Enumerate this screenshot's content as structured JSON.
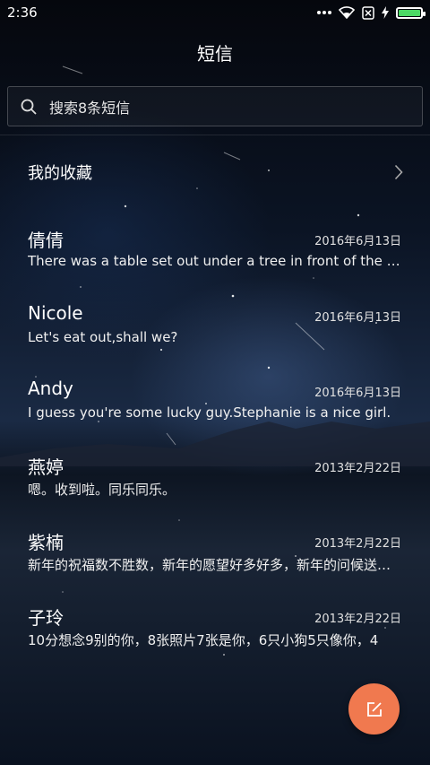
{
  "status_bar": {
    "time": "2:36",
    "icons": [
      "more-dots-icon",
      "wifi-icon",
      "sim-disabled-icon",
      "charging-icon",
      "battery-icon"
    ],
    "battery_color": "#4cd964"
  },
  "header": {
    "title": "短信"
  },
  "search": {
    "placeholder": "搜索8条短信"
  },
  "favorites": {
    "label": "我的收藏"
  },
  "messages": [
    {
      "name": "倩倩",
      "date": "2016年6月13日",
      "preview": "There was a table set out under a tree in front of the house"
    },
    {
      "name": "Nicole",
      "date": "2016年6月13日",
      "preview": "Let's eat out,shall we?"
    },
    {
      "name": "Andy",
      "date": "2016年6月13日",
      "preview": "I guess you're some lucky guy.Stephanie is a nice girl."
    },
    {
      "name": "燕婷",
      "date": "2013年2月22日",
      "preview": "嗯。收到啦。同乐同乐。"
    },
    {
      "name": "紫楠",
      "date": "2013年2月22日",
      "preview": "新年的祝福数不胜数，新年的愿望好多好多，新年的问候送给你"
    },
    {
      "name": "子玲",
      "date": "2013年2月22日",
      "preview": "10分想念9别的你，8张照片7张是你，6只小狗5只像你，4"
    }
  ],
  "fab": {
    "icon": "compose-icon",
    "color": "#f0794f"
  }
}
